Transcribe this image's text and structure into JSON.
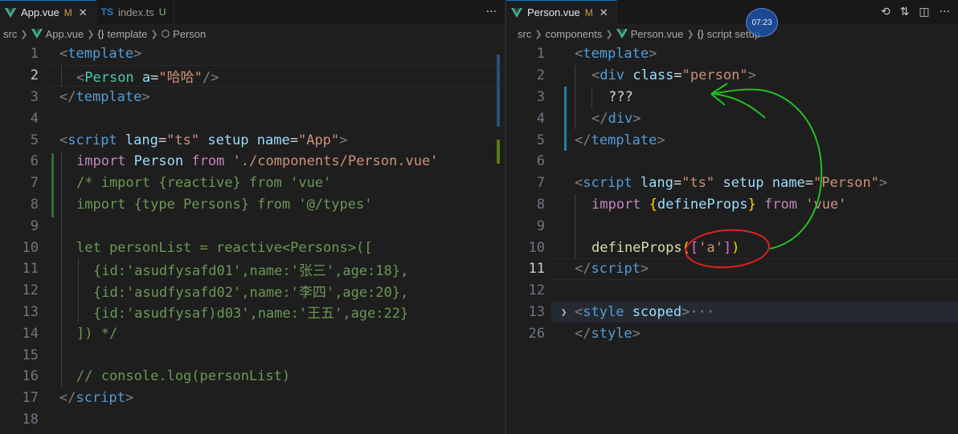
{
  "left": {
    "tabs": [
      {
        "label": "App.vue",
        "status": "M",
        "icon": "vue-icon",
        "active": true
      },
      {
        "label": "index.ts",
        "status": "U",
        "icon": "ts-icon",
        "active": false
      }
    ],
    "more_label": "···",
    "breadcrumb": [
      "src",
      "App.vue",
      "template",
      "Person"
    ],
    "line_numbers": [
      "1",
      "2",
      "3",
      "4",
      "5",
      "6",
      "7",
      "8",
      "9",
      "10",
      "11",
      "12",
      "13",
      "14",
      "15",
      "16",
      "17",
      "18"
    ],
    "current_line": "2",
    "code": {
      "l1": {
        "open": "<",
        "tag": "template",
        "close": ">"
      },
      "l2": {
        "open": "<",
        "comp": "Person",
        "attr": "a",
        "eq": "=",
        "str": "\"哈哈\"",
        "close": "/>"
      },
      "l3": {
        "open": "</",
        "tag": "template",
        "close": ">"
      },
      "l5": {
        "open": "<",
        "tag": "script",
        "a1": "lang",
        "eq1": "=",
        "v1": "\"ts\"",
        "a2": "setup",
        "a3": "name",
        "eq3": "=",
        "v3": "\"App\"",
        "close": ">"
      },
      "l6": {
        "kw1": "import",
        "id": "Person",
        "kw2": "from",
        "str": "'./components/Person.vue'"
      },
      "l7": "/* import {reactive} from 'vue'",
      "l8": "import {type Persons} from '@/types'",
      "l10": "let personList = reactive<Persons>([",
      "l11": "{id:'asudfysafd01',name:'张三',age:18},",
      "l12": "{id:'asudfysafd02',name:'李四',age:20},",
      "l13": "{id:'asudfysaf)d03',name:'王五',age:22}",
      "l14": "]) */",
      "l16": "// console.log(personList)",
      "l17": {
        "open": "</",
        "tag": "script",
        "close": ">"
      }
    }
  },
  "right": {
    "tabs": [
      {
        "label": "Person.vue",
        "status": "M",
        "icon": "vue-icon",
        "active": true
      }
    ],
    "breadcrumb": [
      "src",
      "components",
      "Person.vue",
      "script setup"
    ],
    "timer": "07:23",
    "line_numbers": [
      "1",
      "2",
      "3",
      "4",
      "5",
      "6",
      "7",
      "8",
      "9",
      "10",
      "11",
      "12",
      "13",
      "26"
    ],
    "current_line": "11",
    "code": {
      "l1": {
        "open": "<",
        "tag": "template",
        "close": ">"
      },
      "l2": {
        "open": "<",
        "tag": "div",
        "attr": "class",
        "eq": "=",
        "q1": "\"",
        "val": "person",
        "q2": "\"",
        "close": ">"
      },
      "l3": "???",
      "l4": {
        "open": "</",
        "tag": "div",
        "close": ">"
      },
      "l5": {
        "open": "</",
        "tag": "template",
        "close": ">"
      },
      "l7": {
        "open": "<",
        "tag": "script",
        "a1": "lang",
        "eq1": "=",
        "v1": "\"ts\"",
        "a2": "setup",
        "a3": "name",
        "eq3": "=",
        "v3": "\"Person\"",
        "close": ">"
      },
      "l8": {
        "kw1": "import",
        "lb": "{",
        "id": "defineProps",
        "rb": "}",
        "kw2": "from",
        "str": "'vue'"
      },
      "l10": {
        "fn": "defineProps",
        "lp": "(",
        "lb": "[",
        "str": "'a'",
        "rb": "]",
        "rp": ")"
      },
      "l11": {
        "open": "</",
        "tag": "script",
        "close": ">"
      },
      "l13": {
        "open": "<",
        "tag": "style",
        "attr": "scoped",
        "close": ">",
        "fold": "···"
      },
      "l26": {
        "open": "</",
        "tag": "style",
        "close": ">"
      }
    }
  },
  "colors": {
    "background": "#1e1e1e",
    "tag": "#569cd6",
    "component": "#4ec9b0",
    "attribute": "#9cdcfe",
    "string": "#ce9178",
    "keyword": "#c586c0",
    "comment": "#6a9955",
    "annotation_green": "#22c022",
    "annotation_red": "#e02020"
  }
}
